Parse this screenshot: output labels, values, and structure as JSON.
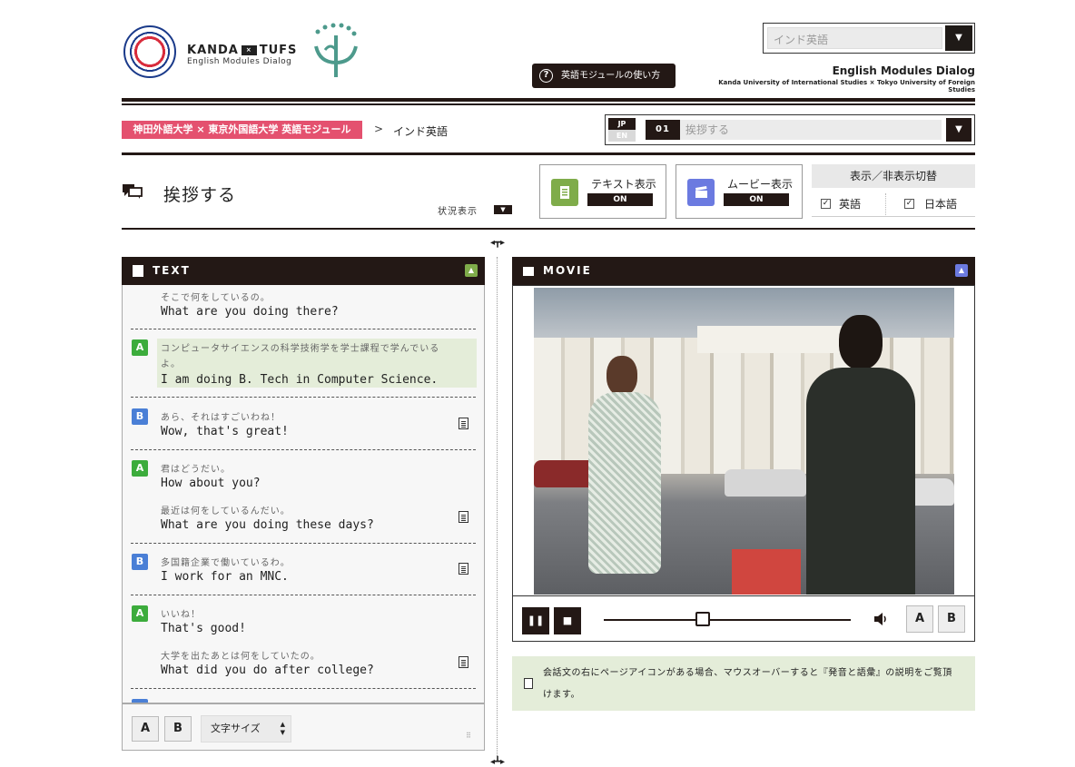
{
  "header": {
    "logo_kanda": "KANDA",
    "logo_x": "×",
    "logo_tufs": "TUFS",
    "logo_sub": "English Modules Dialog",
    "language_select": {
      "value": "インド英語",
      "toggle": "▼"
    },
    "howto_label": "英語モジュールの使い方",
    "howto_icon": "question-icon",
    "brand_title": "English Modules Dialog",
    "brand_sub": "Kanda University of International Studies × Tokyo University of Foreign Studies"
  },
  "breadcrumb": {
    "root": "神田外語大学 × 東京外国語大学 英語モジュール",
    "sep": ">",
    "current": "インド英語"
  },
  "scene_select": {
    "jp": "JP",
    "en": "EN",
    "number": "01",
    "value": "挨拶する",
    "toggle": "▼"
  },
  "page": {
    "title": "挨拶する",
    "status_label": "状況表示",
    "status_toggle": "▼"
  },
  "toggles": {
    "text": {
      "label": "テキスト表示",
      "state": "ON",
      "color": "#7fac4a"
    },
    "movie": {
      "label": "ムービー表示",
      "state": "ON",
      "color": "#6b7ae0"
    }
  },
  "display_switch": {
    "title": "表示／非表示切替",
    "english": {
      "label": "英語",
      "checked": true
    },
    "japanese": {
      "label": "日本語",
      "checked": true
    }
  },
  "text_panel": {
    "title": "TEXT",
    "collapse_icon": "▲",
    "lines": [
      {
        "speaker": "",
        "jp": "そこで何をしているの。",
        "en": "What are you doing there?"
      },
      {
        "speaker": "A",
        "jp": "コンピュータサイエンスの科学技術学を学士課程で学んでいる",
        "jp2": "よ。",
        "en": "I am doing B. Tech in Computer Science."
      },
      {
        "speaker": "B",
        "jp": "あら、それはすごいわね！",
        "en": "Wow, that's great!"
      },
      {
        "speaker": "A",
        "jp": "君はどうだい。",
        "en": "How about you?",
        "jp_b": "最近は何をしているんだい。",
        "en_b": "What are you doing these days?"
      },
      {
        "speaker": "B",
        "jp": "多国籍企業で働いているわ。",
        "en": "I work for an MNC."
      },
      {
        "speaker": "A",
        "jp": "いいね！",
        "en": "That's good!",
        "jp_b": "大学を出たあとは何をしていたの。",
        "en_b": "What did you do after college?"
      }
    ],
    "footer": {
      "btn_a": "A",
      "btn_b": "B",
      "font_size_label": "文字サイズ",
      "spin_up": "▲",
      "spin_down": "▼"
    }
  },
  "movie_panel": {
    "title": "MOVIE",
    "collapse_icon": "▲",
    "controls": {
      "pause": "❚❚",
      "stop": "■",
      "progress": 0.4,
      "btn_a": "A",
      "btn_b": "B"
    },
    "note": "会話文の右にページアイコンがある場合、マウスオーバーすると『発音と語彙』の説明をご覧頂けます。"
  },
  "colors": {
    "accent_dark": "#231815",
    "pink": "#e4516f",
    "speaker_a": "#3cac3c",
    "speaker_b": "#4a7fd6",
    "note_bg": "#e4edd9"
  }
}
